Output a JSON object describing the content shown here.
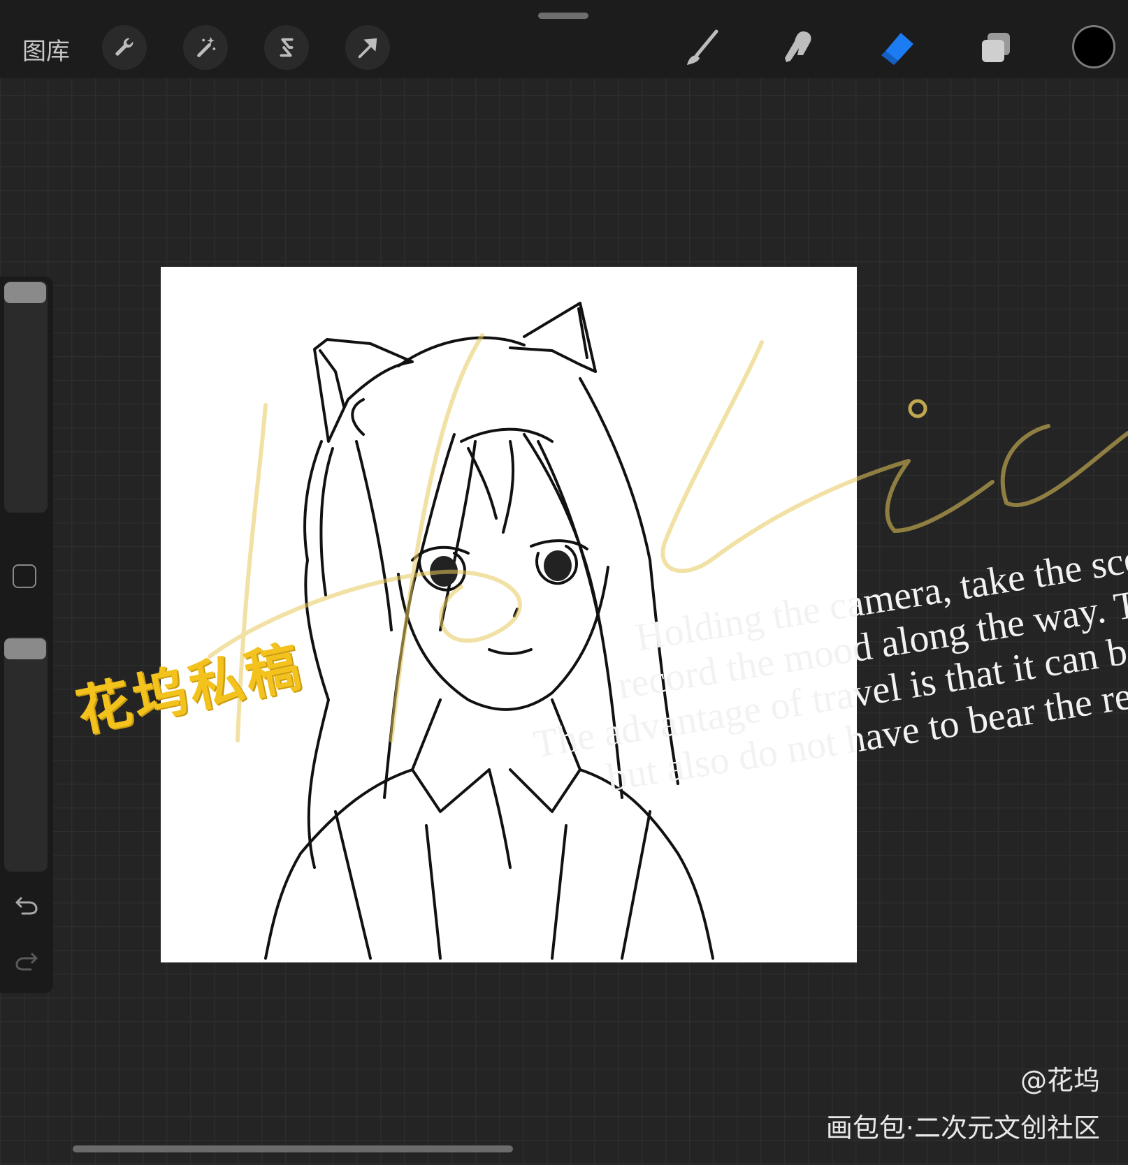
{
  "toolbar": {
    "gallery_label": "图库",
    "left_tools": [
      "wrench-icon",
      "magic-wand-icon",
      "selection-s-icon",
      "transform-arrow-icon"
    ],
    "right_tools": [
      "brush-icon",
      "smudge-icon",
      "eraser-icon",
      "layers-icon"
    ],
    "active_tool": "eraser-icon",
    "active_color": "#1c7cf4",
    "current_color": "#000000"
  },
  "watermark": {
    "signature": "Holio",
    "stamp": "花坞私稿",
    "stamp_color": "#f3c21d",
    "quote_lines": [
      "Holding the camera, take the scenery",
      "record the mood along the way. That li",
      "The advantage of travel is that it can be far a",
      "but also do not have to bear the responsi"
    ],
    "handle": "@花坞",
    "brand": "画包包·二次元文创社区"
  }
}
